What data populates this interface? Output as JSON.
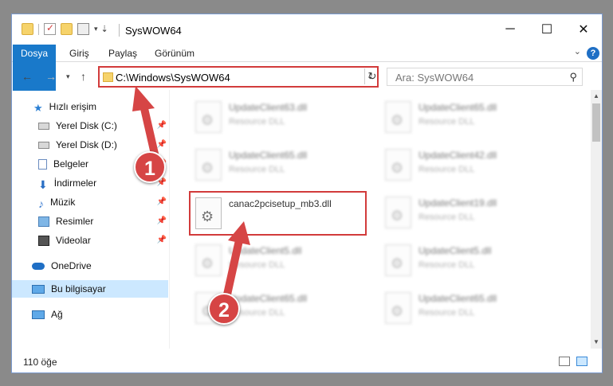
{
  "window": {
    "title": "SysWOW64"
  },
  "ribbon": {
    "tabs": [
      "Dosya",
      "Giriş",
      "Paylaş",
      "Görünüm"
    ],
    "help": "?"
  },
  "address": {
    "path": "C:\\Windows\\SysWOW64"
  },
  "search": {
    "placeholder": "Ara: SysWOW64"
  },
  "sidebar": {
    "quick_access": "Hızlı erişim",
    "items": [
      {
        "label": "Yerel Disk (C:)"
      },
      {
        "label": "Yerel Disk (D:)"
      },
      {
        "label": "Belgeler"
      },
      {
        "label": "İndirmeler"
      },
      {
        "label": "Müzik"
      },
      {
        "label": "Resimler"
      },
      {
        "label": "Videolar"
      }
    ],
    "onedrive": "OneDrive",
    "this_pc": "Bu bilgisayar",
    "network": "Ağ"
  },
  "files": {
    "col1": [
      {
        "name": "UpdateClient63.dll",
        "type": "Resource DLL"
      },
      {
        "name": "UpdateClient65.dll",
        "type": "Resource DLL"
      },
      {
        "name": "canac2pcisetup_mb3.dll",
        "type": ""
      },
      {
        "name": "UpdateClient5.dll",
        "type": "Resource DLL"
      },
      {
        "name": "UpdateClient65.dll",
        "type": "Resource DLL"
      }
    ],
    "col2": [
      {
        "name": "UpdateClient65.dll",
        "type": "Resource DLL"
      },
      {
        "name": "UpdateClient42.dll",
        "type": "Resource DLL"
      },
      {
        "name": "UpdateClient19.dll",
        "type": "Resource DLL"
      },
      {
        "name": "UpdateClient5.dll",
        "type": "Resource DLL"
      },
      {
        "name": "UpdateClient65.dll",
        "type": "Resource DLL"
      }
    ]
  },
  "status": {
    "count": "110 öğe"
  },
  "annotations": {
    "step1": "1",
    "step2": "2"
  },
  "colors": {
    "accent": "#1979ca",
    "highlight": "#d23b3b",
    "selected": "#cce8ff"
  }
}
